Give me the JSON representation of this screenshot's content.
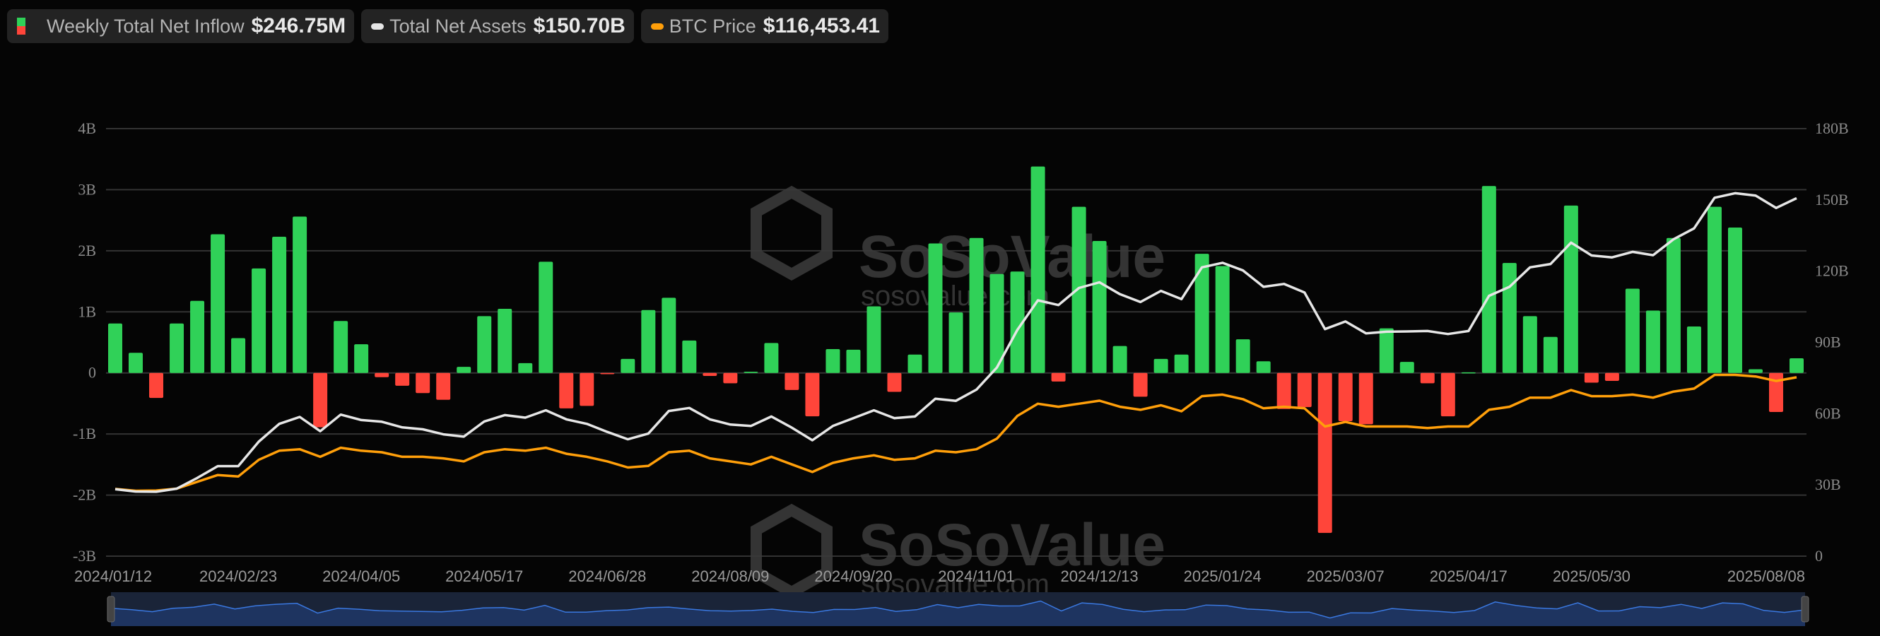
{
  "legend": {
    "inflow": {
      "label": "Weekly Total Net Inflow",
      "value": "$246.75M"
    },
    "assets": {
      "label": "Total Net Assets",
      "value": "$150.70B"
    },
    "btc": {
      "label": "BTC Price",
      "value": "$116,453.41"
    }
  },
  "watermark": {
    "brand": "SoSoValue",
    "site": "sosovalue.com"
  },
  "colors": {
    "positive": "#30d158",
    "negative": "#ff453a",
    "assets": "#e6e6e6",
    "btc": "#ff9f0a",
    "grid": "#333333",
    "navigator": "#1e3460",
    "navigator_line": "#3a78e0"
  },
  "chart_data": {
    "type": "bar+line",
    "left_axis": {
      "ticks": [
        "4B",
        "3B",
        "2B",
        "1B",
        "0",
        "-1B",
        "-2B",
        "-3B"
      ],
      "tick_values": [
        4,
        3,
        2,
        1,
        0,
        -1,
        -2,
        -3
      ],
      "range": [
        -3,
        4
      ],
      "unit": "B USD"
    },
    "right_axis": {
      "ticks": [
        "180B",
        "150B",
        "120B",
        "90B",
        "60B",
        "30B",
        "0"
      ],
      "tick_values": [
        180,
        150,
        120,
        90,
        60,
        30,
        0
      ],
      "range": [
        0,
        180
      ],
      "unit": "B USD"
    },
    "btc_hidden_axis_range": [
      -1.5,
      280.4
    ],
    "x_labels": [
      {
        "index": 0,
        "label": "2024/01/12"
      },
      {
        "index": 6,
        "label": "2024/02/23"
      },
      {
        "index": 12,
        "label": "2024/04/05"
      },
      {
        "index": 18,
        "label": "2024/05/17"
      },
      {
        "index": 24,
        "label": "2024/06/28"
      },
      {
        "index": 30,
        "label": "2024/08/09"
      },
      {
        "index": 36,
        "label": "2024/09/20"
      },
      {
        "index": 42,
        "label": "2024/11/01"
      },
      {
        "index": 48,
        "label": "2024/12/13"
      },
      {
        "index": 54,
        "label": "2025/01/24"
      },
      {
        "index": 60,
        "label": "2025/03/07"
      },
      {
        "index": 66,
        "label": "2025/04/17"
      },
      {
        "index": 72,
        "label": "2025/05/30"
      },
      {
        "index": 82,
        "label": "2025/08/08"
      }
    ],
    "series": [
      {
        "name": "Weekly Total Net Inflow",
        "type": "bar",
        "unit": "B USD",
        "values": [
          0.81,
          0.33,
          -0.41,
          0.81,
          1.18,
          2.27,
          0.57,
          1.71,
          2.23,
          2.56,
          -0.89,
          0.85,
          0.47,
          -0.07,
          -0.21,
          -0.33,
          -0.44,
          0.1,
          0.93,
          1.05,
          0.16,
          1.82,
          -0.58,
          -0.54,
          -0.02,
          0.23,
          1.03,
          1.23,
          0.53,
          -0.05,
          -0.17,
          0.02,
          0.49,
          -0.28,
          -0.71,
          0.39,
          0.38,
          1.09,
          -0.31,
          0.3,
          2.12,
          0.99,
          2.21,
          1.62,
          1.66,
          3.38,
          -0.14,
          2.72,
          2.16,
          0.44,
          -0.39,
          0.23,
          0.3,
          1.95,
          1.75,
          0.55,
          0.19,
          -0.59,
          -0.56,
          -2.62,
          -0.79,
          -0.84,
          0.73,
          0.18,
          -0.17,
          -0.71,
          0.01,
          3.06,
          1.8,
          0.93,
          0.59,
          2.74,
          -0.16,
          -0.13,
          1.38,
          1.02,
          2.21,
          0.76,
          2.72,
          2.38,
          0.06,
          -0.64,
          0.24
        ]
      },
      {
        "name": "Total Net Assets",
        "type": "line",
        "unit": "B USD",
        "values": [
          28.2,
          27.2,
          27.1,
          28.4,
          32.9,
          37.9,
          37.9,
          48.2,
          55.7,
          58.6,
          52.6,
          59.6,
          57.3,
          56.6,
          54.2,
          53.4,
          51.3,
          50.3,
          56.7,
          59.4,
          58.3,
          61.4,
          57.6,
          55.7,
          52.3,
          49.2,
          51.6,
          61.1,
          62.4,
          57.6,
          55.4,
          54.8,
          58.8,
          54.1,
          48.8,
          54.8,
          58.1,
          61.4,
          58.1,
          58.8,
          66.3,
          65.4,
          70.1,
          79.4,
          95.3,
          107.7,
          105.7,
          112.9,
          115.3,
          110.3,
          107.0,
          111.7,
          108.2,
          121.6,
          123.5,
          120.3,
          113.4,
          114.6,
          111.0,
          95.6,
          98.8,
          93.8,
          94.5,
          94.6,
          94.8,
          93.5,
          94.8,
          109.6,
          113.4,
          121.6,
          123.0,
          132.0,
          126.6,
          125.8,
          128.1,
          126.7,
          133.4,
          138.0,
          150.9,
          152.8,
          151.8,
          146.6,
          150.7
        ]
      },
      {
        "name": "BTC Price",
        "type": "line",
        "unit": "K USD",
        "values": [
          42.8,
          41.6,
          41.8,
          43.0,
          47.5,
          52.0,
          51.0,
          62.0,
          68.0,
          69.0,
          64.0,
          70.0,
          68.0,
          67.0,
          64.0,
          64.0,
          63.0,
          61.0,
          67.0,
          69.0,
          68.0,
          70.0,
          66.0,
          64.0,
          61.0,
          57.0,
          58.0,
          67.0,
          68.0,
          63.0,
          61.0,
          59.0,
          64.0,
          59.0,
          54.0,
          60.0,
          63.0,
          65.0,
          62.0,
          63.0,
          68.0,
          67.0,
          69.0,
          76.0,
          91.0,
          99.0,
          97.0,
          99.0,
          101.0,
          97.0,
          95.0,
          98.0,
          94.0,
          104.0,
          105.0,
          102.0,
          96.0,
          97.0,
          96.0,
          84.0,
          87.0,
          84.0,
          84.0,
          84.0,
          83.0,
          84.0,
          84.0,
          95.0,
          97.0,
          103.0,
          103.0,
          108.0,
          104.0,
          104.0,
          105.0,
          103.0,
          107.0,
          109.0,
          118.0,
          118.0,
          117.0,
          114.0,
          116.45
        ]
      }
    ],
    "grid": true,
    "legend_position": "top-left"
  }
}
